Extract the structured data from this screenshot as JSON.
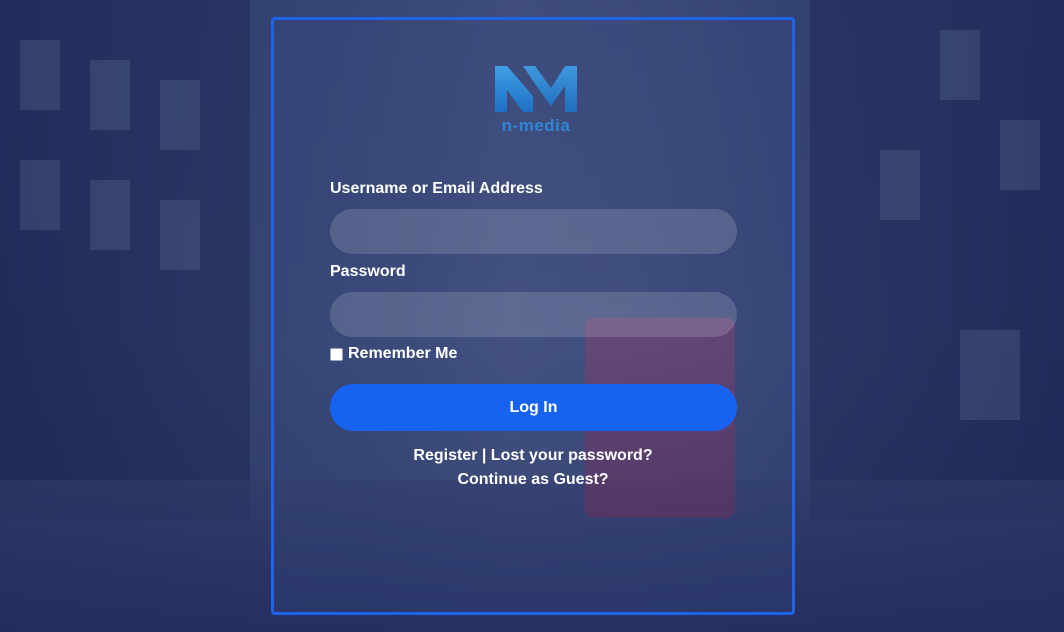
{
  "brand": {
    "logo_text": "n-media",
    "colors": {
      "logo_dark": "#1e6fc4",
      "logo_light": "#3fa0e6",
      "accent": "#1f63e8",
      "button": "#1763f0"
    }
  },
  "form": {
    "username_label": "Username or Email Address",
    "username_value": "",
    "password_label": "Password",
    "password_value": "",
    "remember_label": "Remember Me",
    "remember_checked": false,
    "login_button": "Log In"
  },
  "links": {
    "register": "Register",
    "separator": " | ",
    "lost_password": "Lost your password?",
    "guest": "Continue as Guest?"
  }
}
